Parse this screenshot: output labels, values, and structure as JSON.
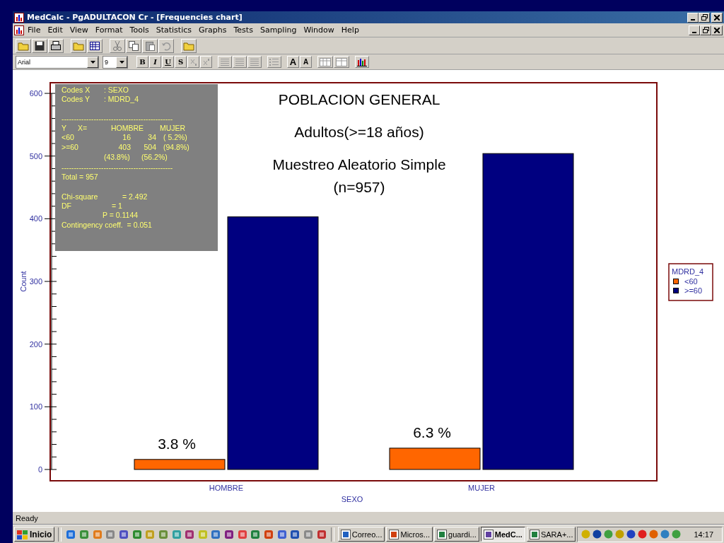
{
  "window": {
    "title": "MedCalc - PgADULTACON Cr - [Frequencies chart]"
  },
  "menu": [
    "File",
    "Edit",
    "View",
    "Format",
    "Tools",
    "Statistics",
    "Graphs",
    "Tests",
    "Sampling",
    "Window",
    "Help"
  ],
  "format_bar": {
    "font": "Arial",
    "size": "9",
    "style_buttons": [
      "B",
      "I",
      "U",
      "S"
    ],
    "font_size_buttons": [
      "A",
      "A"
    ]
  },
  "chart": {
    "titles": [
      "POBLACION GENERAL",
      "Adultos(>=18 años)",
      "Muestreo Aleatorio Simple",
      "(n=957)"
    ],
    "bar_labels": [
      "3.8 %",
      "6.3 %"
    ],
    "stats_box": [
      {
        "kind": "pair",
        "cells": [
          "Codes X",
          ": SEXO"
        ]
      },
      {
        "kind": "pair",
        "cells": [
          "Codes Y",
          ": MDRD_4"
        ]
      },
      {
        "kind": "text",
        "cells": [
          "---------------------------------------------"
        ]
      },
      {
        "kind": "head",
        "cells": [
          "Y",
          "X=",
          "HOMBRE",
          "MUJER"
        ]
      },
      {
        "kind": "row",
        "cells": [
          "<60",
          "16",
          "34",
          "( 5.2%)"
        ]
      },
      {
        "kind": "row",
        "cells": [
          ">=60",
          "403",
          "504",
          "(94.8%)"
        ]
      },
      {
        "kind": "foot",
        "cells": [
          "(43.8%)",
          "(56.2%)"
        ]
      },
      {
        "kind": "text",
        "cells": [
          "---------------------------------------------"
        ]
      },
      {
        "kind": "text",
        "cells": [
          "Total = 957"
        ]
      },
      {
        "kind": "stat",
        "cells": [
          "Chi-square",
          "= 2.492"
        ]
      },
      {
        "kind": "stat2",
        "cells": [
          "DF",
          "= 1"
        ]
      },
      {
        "kind": "indent",
        "cells": [
          "P = 0.1144"
        ]
      },
      {
        "kind": "text",
        "cells": [
          "Contingency coeff.  = 0.051"
        ]
      }
    ],
    "chart_data": {
      "type": "bar",
      "legend": {
        "title": "MDRD_4"
      },
      "xlabel": "SEXO",
      "ylabel": "Count",
      "categories": [
        "HOMBRE",
        "MUJER"
      ],
      "series": [
        {
          "name": "<60",
          "color": "#ff6600",
          "values": [
            16,
            34
          ]
        },
        {
          "name": ">=60",
          "color": "#000080",
          "values": [
            403,
            504
          ]
        }
      ],
      "ylim": [
        0,
        617
      ],
      "yticks": [
        0,
        100,
        200,
        300,
        400,
        500,
        600
      ]
    }
  },
  "status_bar": "Ready",
  "taskbar": {
    "start": "Inicio",
    "tasks": [
      {
        "label": "Correo...",
        "selected": false
      },
      {
        "label": "Micros...",
        "selected": false
      },
      {
        "label": "guardi...",
        "selected": false
      },
      {
        "label": "MedC...",
        "selected": true
      },
      {
        "label": "SARA+...",
        "selected": false
      }
    ],
    "clock": "14:17"
  }
}
